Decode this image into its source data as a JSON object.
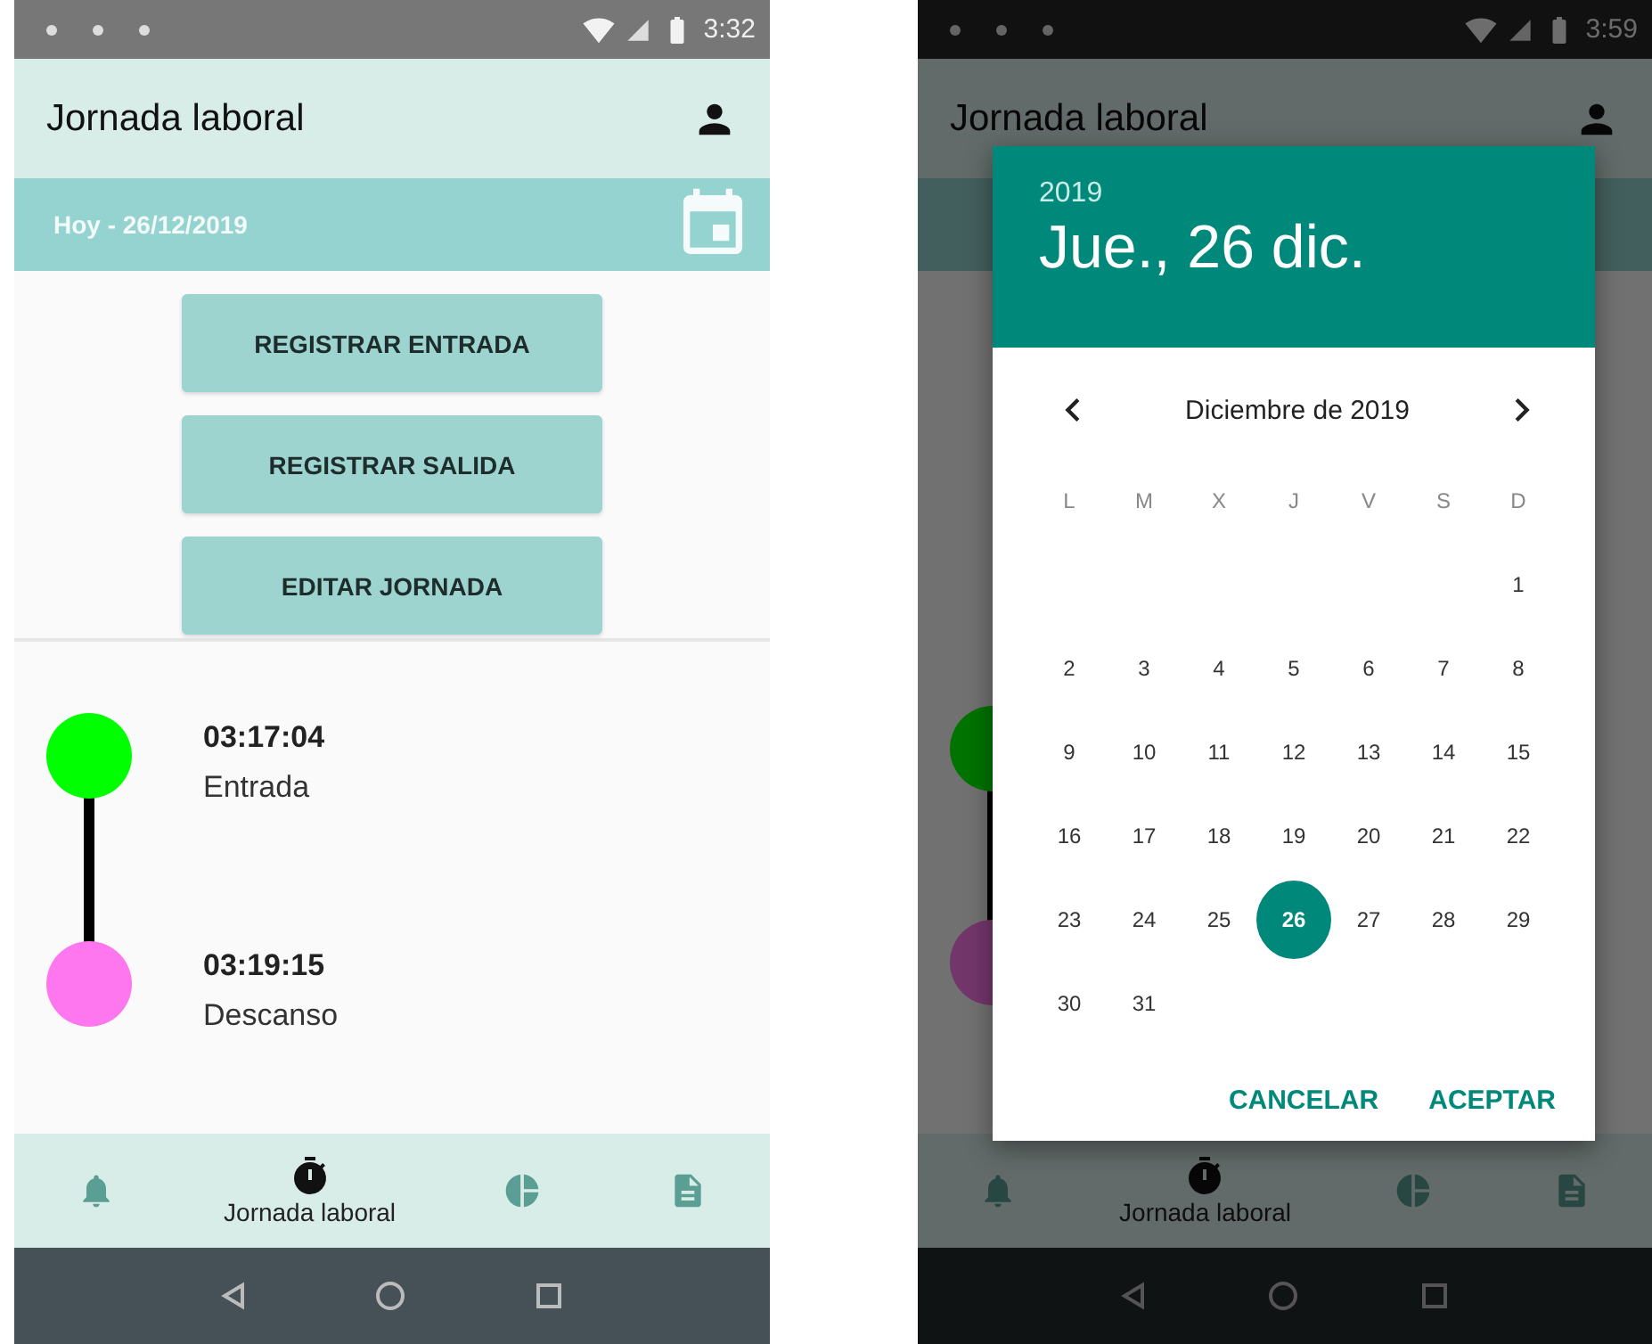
{
  "screens": [
    {
      "kind": "main",
      "status_bar": {
        "time": "3:32"
      },
      "app_bar": {
        "title": "Jornada laboral"
      },
      "date_bar": {
        "label": "Hoy - 26/12/2019"
      },
      "buttons": [
        "REGISTRAR ENTRADA",
        "REGISTRAR SALIDA",
        "EDITAR JORNADA"
      ],
      "timeline": [
        {
          "time": "03:17:04",
          "label": "Entrada",
          "color": "#00ff00"
        },
        {
          "time": "03:19:15",
          "label": "Descanso",
          "color": "#ff77ee"
        }
      ],
      "bottom_nav": [
        {
          "kind": "bell",
          "selected": false
        },
        {
          "kind": "timer",
          "selected": true,
          "label": "Jornada laboral"
        },
        {
          "kind": "chart",
          "selected": false
        },
        {
          "kind": "document",
          "selected": false
        }
      ]
    },
    {
      "kind": "picker",
      "status_bar": {
        "time": "3:59"
      },
      "app_bar": {
        "title": "Jornada laboral"
      },
      "timeline": [
        {
          "color": "#007300"
        },
        {
          "color": "#73366b"
        }
      ],
      "bottom_nav": [
        {
          "kind": "bell",
          "selected": false
        },
        {
          "kind": "timer",
          "selected": true,
          "label": "Jornada laboral"
        },
        {
          "kind": "chart",
          "selected": false
        },
        {
          "kind": "document",
          "selected": false
        }
      ],
      "date_picker": {
        "year": "2019",
        "date": "Jue., 26 dic.",
        "month": "Diciembre de 2019",
        "weekdays": [
          "L",
          "M",
          "X",
          "J",
          "V",
          "S",
          "D"
        ],
        "weeks": [
          [
            {
              "kind": "blank"
            },
            {
              "kind": "blank"
            },
            {
              "kind": "blank"
            },
            {
              "kind": "blank"
            },
            {
              "kind": "blank"
            },
            {
              "kind": "blank"
            },
            {
              "kind": "day",
              "day": "1",
              "selected": false
            }
          ],
          [
            {
              "day": "2",
              "selected": false
            },
            {
              "day": "3",
              "selected": false
            },
            {
              "day": "4",
              "selected": false
            },
            {
              "day": "5",
              "selected": false
            },
            {
              "day": "6",
              "selected": false
            },
            {
              "day": "7",
              "selected": false
            },
            {
              "day": "8",
              "selected": false
            }
          ],
          [
            {
              "day": "9",
              "selected": false
            },
            {
              "day": "10",
              "selected": false
            },
            {
              "day": "11",
              "selected": false
            },
            {
              "day": "12",
              "selected": false
            },
            {
              "day": "13",
              "selected": false
            },
            {
              "day": "14",
              "selected": false
            },
            {
              "day": "15",
              "selected": false
            }
          ],
          [
            {
              "day": "16",
              "selected": false
            },
            {
              "day": "17",
              "selected": false
            },
            {
              "day": "18",
              "selected": false
            },
            {
              "day": "19",
              "selected": false
            },
            {
              "day": "20",
              "selected": false
            },
            {
              "day": "21",
              "selected": false
            },
            {
              "day": "22",
              "selected": false
            }
          ],
          [
            {
              "day": "23",
              "selected": false
            },
            {
              "day": "24",
              "selected": false
            },
            {
              "day": "25",
              "selected": false
            },
            {
              "day": "26",
              "selected": true
            },
            {
              "day": "27",
              "selected": false
            },
            {
              "day": "28",
              "selected": false
            },
            {
              "day": "29",
              "selected": false
            }
          ],
          [
            {
              "day": "30",
              "selected": false
            },
            {
              "day": "31",
              "selected": false
            },
            {
              "kind": "blank"
            },
            {
              "kind": "blank"
            },
            {
              "kind": "blank"
            },
            {
              "kind": "blank"
            },
            {
              "kind": "blank"
            }
          ]
        ],
        "actions": [
          "CANCELAR",
          "ACEPTAR"
        ]
      }
    }
  ]
}
